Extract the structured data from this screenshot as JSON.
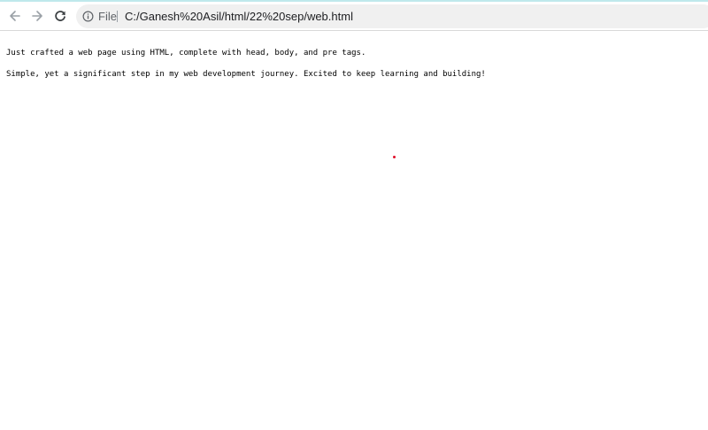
{
  "browser": {
    "nav": {
      "back_icon": "arrow-left-icon",
      "forward_icon": "arrow-right-icon",
      "reload_icon": "reload-icon"
    },
    "omnibox": {
      "info_icon": "info-icon",
      "scheme_label": "File",
      "url": "C:/Ganesh%20Asil/html/22%20sep/web.html"
    },
    "colors": {
      "toolbar_bg": "#ffffff",
      "omnibox_bg": "#f0f0f0",
      "accent_strip": "#bfe9ec",
      "cursor_dot": "#e0102a"
    }
  },
  "page": {
    "lines": [
      "Just crafted a web page using HTML, complete with head, body, and pre tags.",
      "Simple, yet a significant step in my web development journey. Excited to keep learning and building!"
    ]
  }
}
